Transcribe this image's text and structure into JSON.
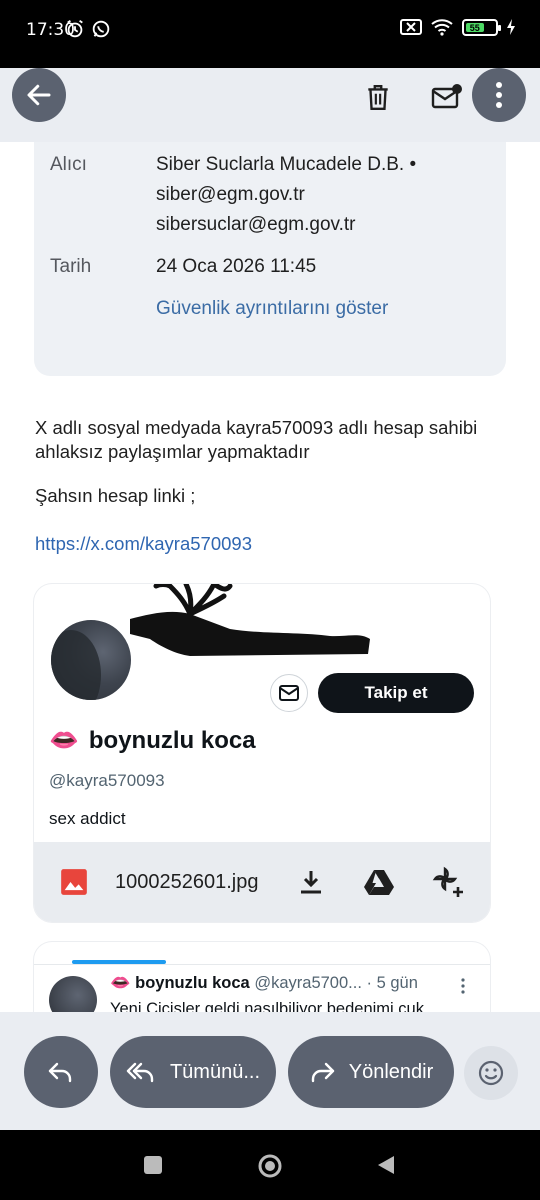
{
  "status_bar": {
    "time": "17:30",
    "battery": "55"
  },
  "details": {
    "recipient_label": "Alıcı",
    "recipient_name": "Siber Suclarla Mucadele D.B. •",
    "recipient_email_1": "siber@egm.gov.tr",
    "recipient_email_2": "sibersuclar@egm.gov.tr",
    "date_label": "Tarih",
    "date_value": "24 Oca 2026 11:45",
    "security_link": "Güvenlik ayrıntılarını göster"
  },
  "body": {
    "line1": "X adlı sosyal medyada kayra570093 adlı hesap sahibi",
    "line2": "ahlaksız paylaşımlar yapmaktadır",
    "line3": "Şahsın hesap linki ;",
    "url": "https://x.com/kayra570093"
  },
  "profile_card": {
    "emoji": "👄",
    "name": "boynuzlu koca",
    "handle": "@kayra570093",
    "bio": "sex addict",
    "follow_label": "Takip et"
  },
  "attachment": {
    "filename": "1000252601.jpg"
  },
  "tweet": {
    "emoji": "👄",
    "name": "boynuzlu koca",
    "handle": "@kayra5700...",
    "age": "· 5 gün",
    "text": "Yeni Cicisler geldi nasılbiliyor bedenimi cuk"
  },
  "actions": {
    "reply_all_label": "Tümünü...",
    "forward_label": "Yönlendir"
  },
  "icons": {
    "back": "arrow-left-icon",
    "delete": "trash-icon",
    "mark_unread": "mail-unread-icon",
    "more": "more-vert-icon",
    "image": "image-icon",
    "download": "download-icon",
    "drive": "drive-icon",
    "photos": "pinwheel-icon",
    "reply": "reply-icon",
    "reply_all": "reply-all-icon",
    "forward": "forward-icon",
    "emoji": "smiley-icon"
  },
  "colors": {
    "accent_link": "#2f66b1",
    "pill": "#5b6270",
    "follow_button": "#0f1419",
    "image_icon": "#e8453c"
  }
}
